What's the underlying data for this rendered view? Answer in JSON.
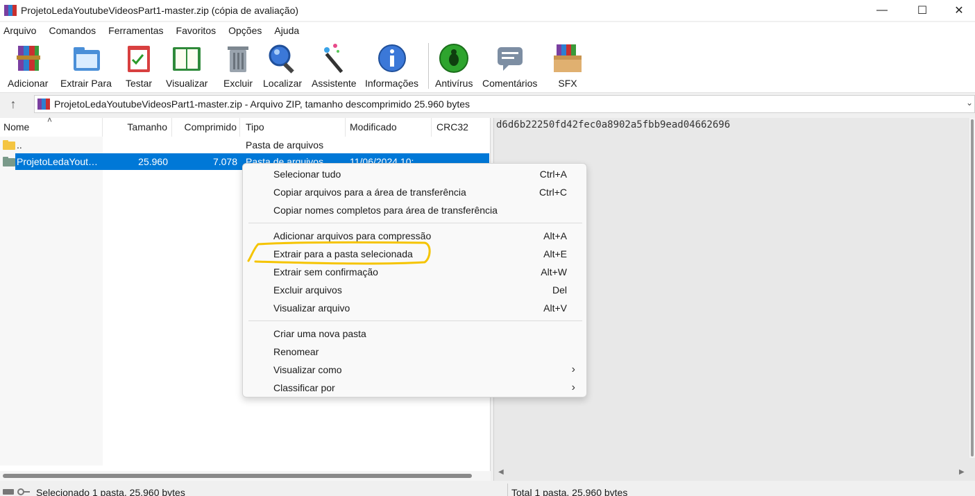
{
  "window": {
    "title": "ProjetoLedaYoutubeVideosPart1-master.zip (cópia de avaliação)",
    "minimize_glyph": "—",
    "maximize_glyph": "☐",
    "close_glyph": "✕"
  },
  "menubar": {
    "items": [
      "Arquivo",
      "Comandos",
      "Ferramentas",
      "Favoritos",
      "Opções",
      "Ajuda"
    ]
  },
  "toolbar": {
    "buttons": [
      {
        "label": "Adicionar",
        "icon": "books-add-icon"
      },
      {
        "label": "Extrair Para",
        "icon": "folder-extract-icon"
      },
      {
        "label": "Testar",
        "icon": "clipboard-check-icon"
      },
      {
        "label": "Visualizar",
        "icon": "open-book-icon"
      },
      {
        "label": "Excluir",
        "icon": "trash-can-icon"
      },
      {
        "label": "Localizar",
        "icon": "magnifier-icon"
      },
      {
        "label": "Assistente",
        "icon": "magic-wand-icon"
      },
      {
        "label": "Informações",
        "icon": "info-icon"
      },
      {
        "label": "Antivírus",
        "icon": "antivirus-bug-icon"
      },
      {
        "label": "Comentários",
        "icon": "comment-bubble-icon"
      },
      {
        "label": "SFX",
        "icon": "sfx-box-icon"
      }
    ]
  },
  "address": {
    "text": "ProjetoLedaYoutubeVideosPart1-master.zip - Arquivo ZIP, tamanho descomprimido 25.960 bytes"
  },
  "filelist": {
    "columns": [
      "Nome",
      "Tamanho",
      "Comprimido",
      "Tipo",
      "Modificado",
      "CRC32"
    ],
    "rows": [
      {
        "name": "..",
        "size": "",
        "packed": "",
        "type": "Pasta de arquivos",
        "modified": "",
        "crc": ""
      },
      {
        "name": "ProjetoLedaYout…",
        "size": "25.960",
        "packed": "7.078",
        "type": "Pasta de arquivos",
        "modified": "11/06/2024 10:",
        "crc": ""
      }
    ]
  },
  "comment": {
    "text": "d6d6b22250fd42fec0a8902a5fbb9ead04662696"
  },
  "status": {
    "left": "Selecionado 1 pasta, 25.960 bytes",
    "right": "Total 1 pasta, 25.960 bytes"
  },
  "context_menu": {
    "groups": [
      [
        {
          "label": "Selecionar tudo",
          "shortcut": "Ctrl+A"
        },
        {
          "label": "Copiar arquivos para a área de transferência",
          "shortcut": "Ctrl+C"
        },
        {
          "label": "Copiar nomes completos para área de transferência",
          "shortcut": ""
        }
      ],
      [
        {
          "label": "Adicionar arquivos para compressão",
          "shortcut": "Alt+A"
        },
        {
          "label": "Extrair para a pasta selecionada",
          "shortcut": "Alt+E"
        },
        {
          "label": "Extrair sem confirmação",
          "shortcut": "Alt+W"
        },
        {
          "label": "Excluir arquivos",
          "shortcut": "Del"
        },
        {
          "label": "Visualizar arquivo",
          "shortcut": "Alt+V"
        }
      ],
      [
        {
          "label": "Criar uma nova pasta",
          "shortcut": ""
        },
        {
          "label": "Renomear",
          "shortcut": ""
        },
        {
          "label": "Visualizar como",
          "shortcut": "",
          "submenu": true
        },
        {
          "label": "Classificar por",
          "shortcut": "",
          "submenu": true
        }
      ]
    ],
    "submenu_glyph": "›"
  },
  "colors": {
    "selection": "#0078d7",
    "annotation_highlight": "#f5c400"
  }
}
